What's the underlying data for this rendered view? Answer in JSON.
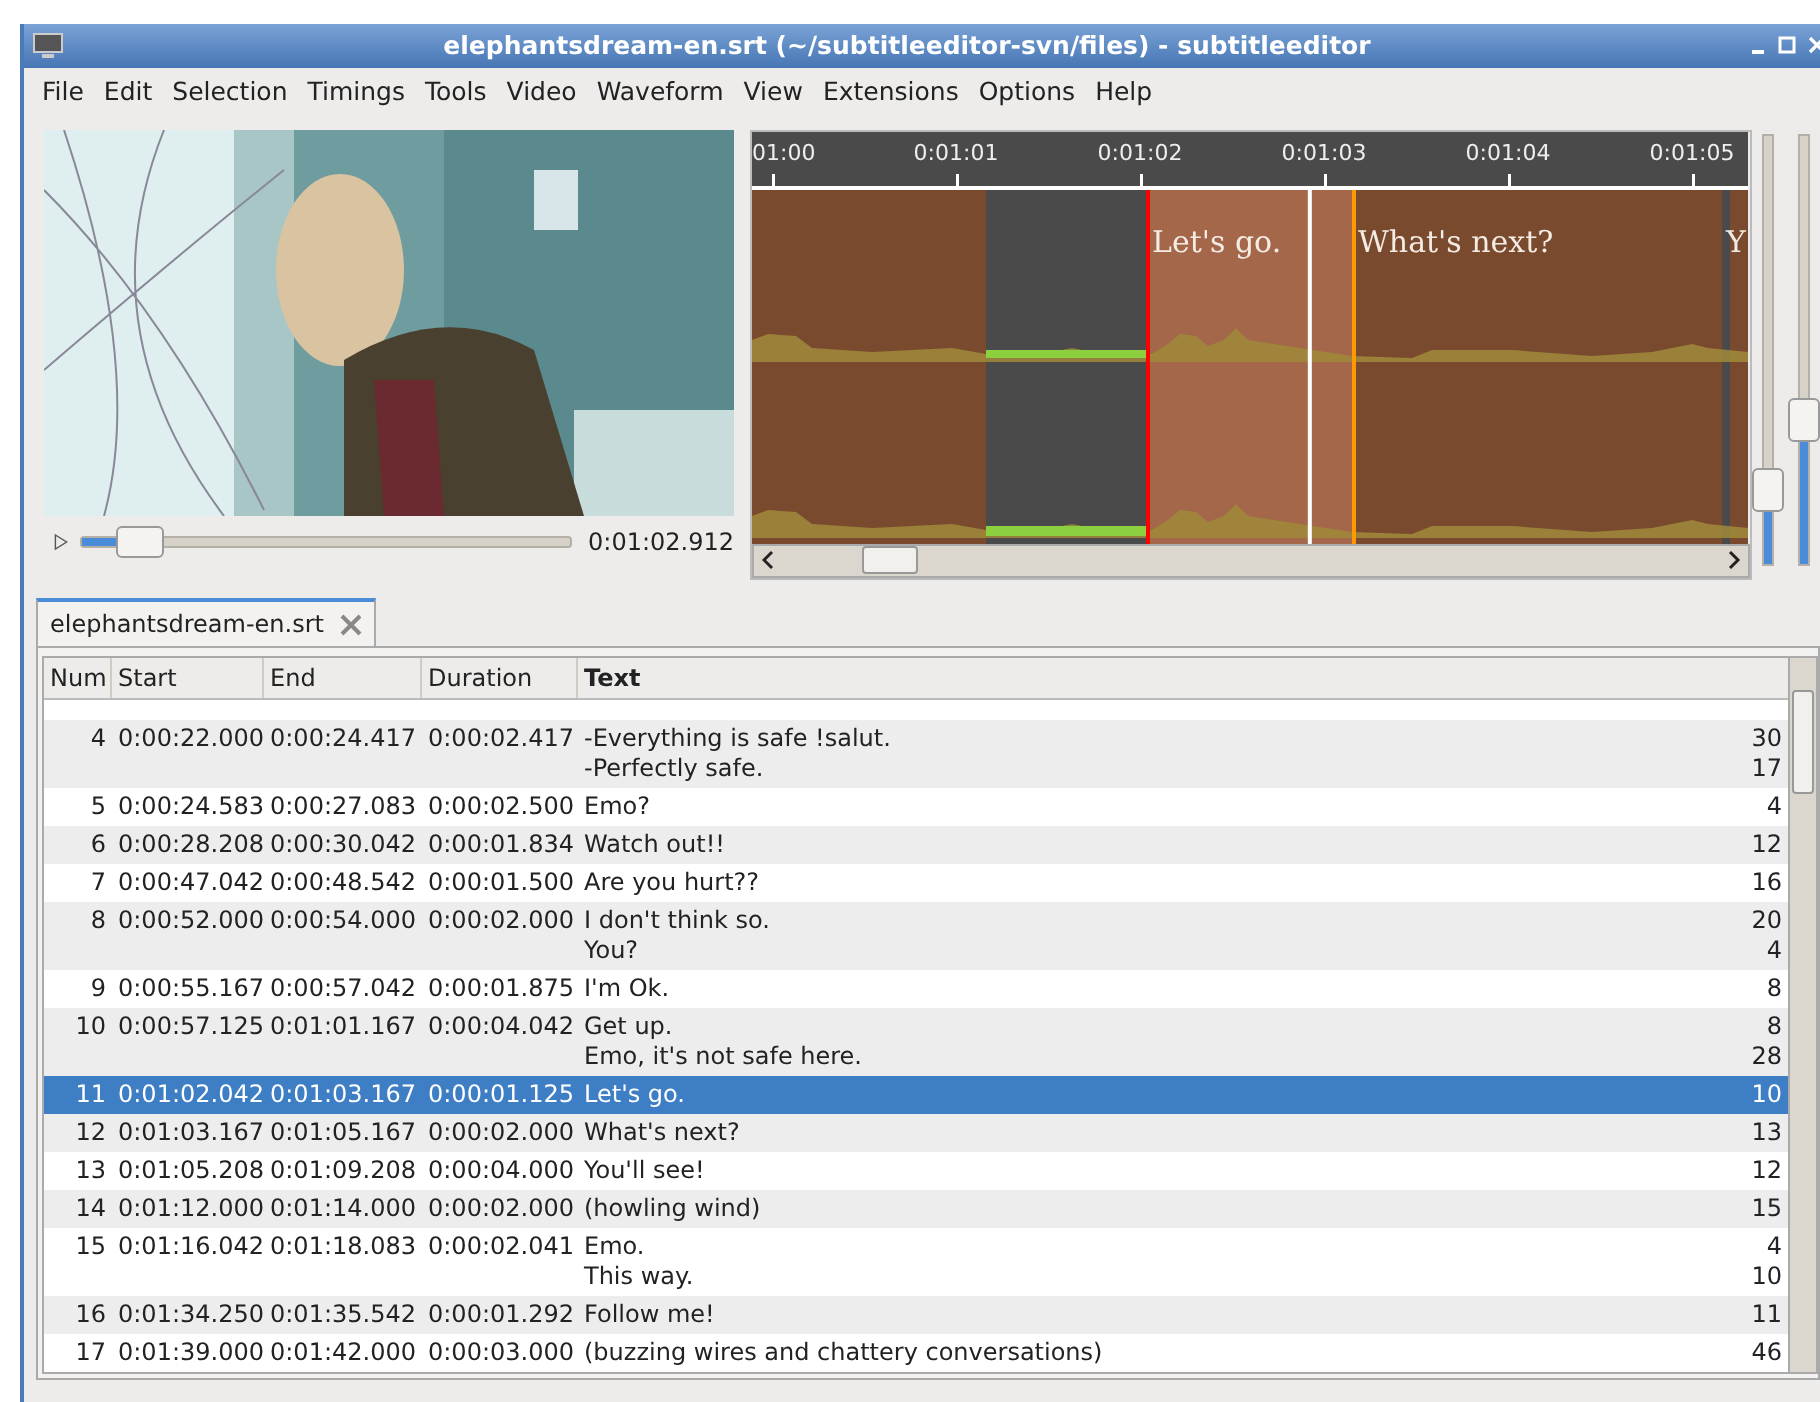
{
  "window": {
    "title": "elephantsdream-en.srt (~/subtitleeditor-svn/files) - subtitleeditor"
  },
  "menu": [
    "File",
    "Edit",
    "Selection",
    "Timings",
    "Tools",
    "Video",
    "Waveform",
    "View",
    "Extensions",
    "Options",
    "Help"
  ],
  "player": {
    "kind": "picture",
    "time": "0:01:02.912",
    "level": 0.12
  },
  "waveform": {
    "ruler": [
      "01:00",
      "0:01:01",
      "0:01:02",
      "0:01:03",
      "0:01:04",
      "0:01:05"
    ],
    "subtitles": [
      {
        "text": "Let's go.",
        "selected": true
      },
      {
        "text": "What's next?",
        "selected": false
      },
      {
        "text": "Y",
        "selected": false
      }
    ]
  },
  "zoom_sliders": [
    {
      "level": 0.17
    },
    {
      "level": 0.33
    }
  ],
  "tabs": [
    {
      "label": "elephantsdream-en.srt",
      "selected": true
    }
  ],
  "table": {
    "columns": [
      "Num",
      "Start",
      "End",
      "Duration",
      "Text"
    ],
    "rows": [
      {
        "num": "4",
        "start": "0:00:22.000",
        "end": "0:00:24.417",
        "duration": "0:00:02.417",
        "text": [
          "-Everything is safe !salut.",
          "-Perfectly safe."
        ],
        "column_6": [
          "30",
          "17"
        ],
        "selected": false
      },
      {
        "num": "5",
        "start": "0:00:24.583",
        "end": "0:00:27.083",
        "duration": "0:00:02.500",
        "text": [
          "Emo?"
        ],
        "column_6": [
          "4"
        ],
        "selected": false
      },
      {
        "num": "6",
        "start": "0:00:28.208",
        "end": "0:00:30.042",
        "duration": "0:00:01.834",
        "text": [
          "Watch out!!"
        ],
        "column_6": [
          "12"
        ],
        "selected": false
      },
      {
        "num": "7",
        "start": "0:00:47.042",
        "end": "0:00:48.542",
        "duration": "0:00:01.500",
        "text": [
          "Are you hurt??"
        ],
        "column_6": [
          "16"
        ],
        "selected": false
      },
      {
        "num": "8",
        "start": "0:00:52.000",
        "end": "0:00:54.000",
        "duration": "0:00:02.000",
        "text": [
          "I don't think so.",
          "You?"
        ],
        "column_6": [
          "20",
          "4"
        ],
        "selected": false
      },
      {
        "num": "9",
        "start": "0:00:55.167",
        "end": "0:00:57.042",
        "duration": "0:00:01.875",
        "text": [
          "I'm Ok."
        ],
        "column_6": [
          "8"
        ],
        "selected": false
      },
      {
        "num": "10",
        "start": "0:00:57.125",
        "end": "0:01:01.167",
        "duration": "0:00:04.042",
        "text": [
          "Get up.",
          "Emo, it's not safe here."
        ],
        "column_6": [
          "8",
          "28"
        ],
        "selected": false
      },
      {
        "num": "11",
        "start": "0:01:02.042",
        "end": "0:01:03.167",
        "duration": "0:00:01.125",
        "text": [
          "Let's go."
        ],
        "column_6": [
          "10"
        ],
        "selected": true
      },
      {
        "num": "12",
        "start": "0:01:03.167",
        "end": "0:01:05.167",
        "duration": "0:00:02.000",
        "text": [
          "What's next?"
        ],
        "column_6": [
          "13"
        ],
        "selected": false
      },
      {
        "num": "13",
        "start": "0:01:05.208",
        "end": "0:01:09.208",
        "duration": "0:00:04.000",
        "text": [
          "You'll see!"
        ],
        "column_6": [
          "12"
        ],
        "selected": false
      },
      {
        "num": "14",
        "start": "0:01:12.000",
        "end": "0:01:14.000",
        "duration": "0:00:02.000",
        "text": [
          "(howling wind)"
        ],
        "column_6": [
          "15"
        ],
        "selected": false
      },
      {
        "num": "15",
        "start": "0:01:16.042",
        "end": "0:01:18.083",
        "duration": "0:00:02.041",
        "text": [
          "Emo.",
          "This way."
        ],
        "column_6": [
          "4",
          "10"
        ],
        "selected": false
      },
      {
        "num": "16",
        "start": "0:01:34.250",
        "end": "0:01:35.542",
        "duration": "0:00:01.292",
        "text": [
          "Follow me!"
        ],
        "column_6": [
          "11"
        ],
        "selected": false
      },
      {
        "num": "17",
        "start": "0:01:39.000",
        "end": "0:01:42.000",
        "duration": "0:00:03.000",
        "text": [
          "(buzzing wires and chattery conversations)"
        ],
        "column_6": [
          "46"
        ],
        "selected": false
      }
    ]
  }
}
